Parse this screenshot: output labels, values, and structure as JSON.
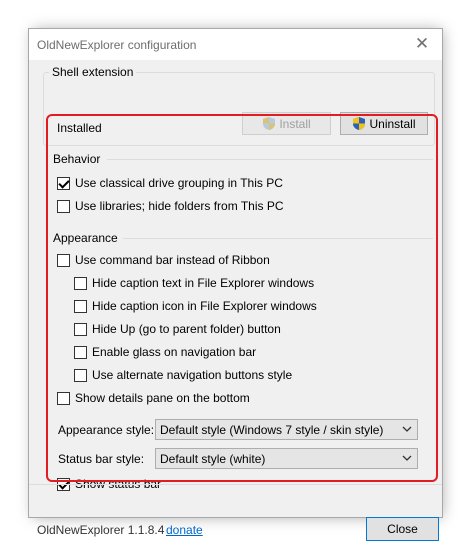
{
  "window": {
    "title": "OldNewExplorer configuration"
  },
  "shell": {
    "group_label": "Shell extension",
    "status": "Installed",
    "install_label": "Install",
    "uninstall_label": "Uninstall"
  },
  "behavior": {
    "group_label": "Behavior",
    "items": [
      {
        "label": "Use classical drive grouping in This PC",
        "checked": true
      },
      {
        "label": "Use libraries; hide folders from This PC",
        "checked": false
      }
    ]
  },
  "appearance": {
    "group_label": "Appearance",
    "items": [
      {
        "label": "Use command bar instead of Ribbon",
        "checked": false
      },
      {
        "label": "Hide caption text in File Explorer windows",
        "checked": false
      },
      {
        "label": "Hide caption icon in File Explorer windows",
        "checked": false
      },
      {
        "label": "Hide Up (go to parent folder) button",
        "checked": false
      },
      {
        "label": "Enable glass on navigation bar",
        "checked": false
      },
      {
        "label": "Use alternate navigation buttons style",
        "checked": false
      },
      {
        "label": "Show details pane on the bottom",
        "checked": false
      }
    ],
    "style_label": "Appearance style:",
    "style_value": "Default style (Windows 7 style / skin style)",
    "statusbar_label": "Status bar style:",
    "statusbar_value": "Default style (white)",
    "show_statusbar": {
      "label": "Show status bar",
      "checked": true
    }
  },
  "footer": {
    "version": "OldNewExplorer 1.1.8.4",
    "donate": "donate",
    "close_label": "Close"
  },
  "colors": {
    "highlight": "#e31b23",
    "accent": "#0078d7",
    "link": "#0066cc"
  }
}
